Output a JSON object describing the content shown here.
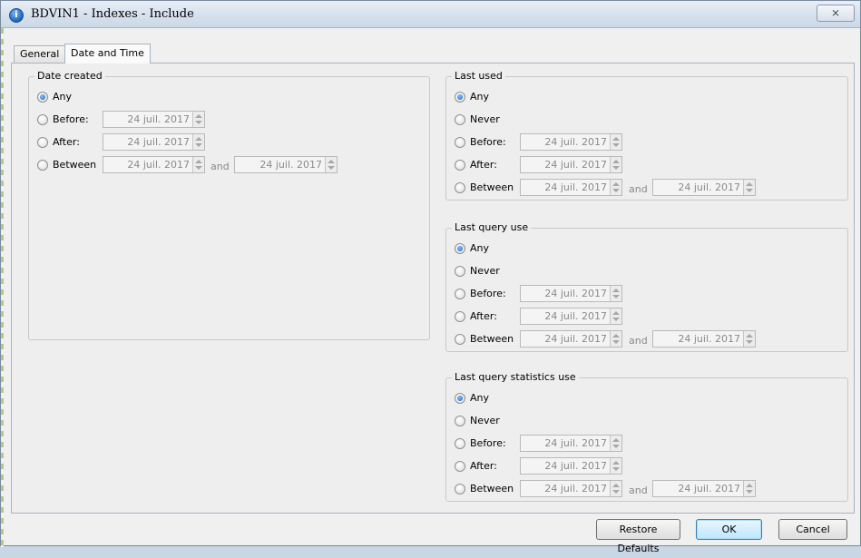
{
  "window": {
    "title": "BDVIN1 - Indexes - Include",
    "close_symbol": "⨯"
  },
  "tabs": [
    {
      "label": "General",
      "active": false
    },
    {
      "label": "Date and Time",
      "active": true
    }
  ],
  "date_created": {
    "title": "Date created",
    "options": [
      {
        "label": "Any",
        "checked": true
      },
      {
        "label": "Before:",
        "date": "24 juil. 2017"
      },
      {
        "label": "After:",
        "date": "24 juil. 2017"
      },
      {
        "label": "Between",
        "date": "24 juil. 2017",
        "and_label": "and",
        "date2": "24 juil. 2017"
      }
    ]
  },
  "last_used": {
    "title": "Last used",
    "options": [
      {
        "label": "Any",
        "checked": true
      },
      {
        "label": "Never"
      },
      {
        "label": "Before:",
        "date": "24 juil. 2017"
      },
      {
        "label": "After:",
        "date": "24 juil. 2017"
      },
      {
        "label": "Between",
        "date": "24 juil. 2017",
        "and_label": "and",
        "date2": "24 juil. 2017"
      }
    ]
  },
  "last_query_use": {
    "title": "Last query use",
    "options": [
      {
        "label": "Any",
        "checked": true
      },
      {
        "label": "Never"
      },
      {
        "label": "Before:",
        "date": "24 juil. 2017"
      },
      {
        "label": "After:",
        "date": "24 juil. 2017"
      },
      {
        "label": "Between",
        "date": "24 juil. 2017",
        "and_label": "and",
        "date2": "24 juil. 2017"
      }
    ]
  },
  "last_query_statistics_use": {
    "title": "Last query statistics use",
    "options": [
      {
        "label": "Any",
        "checked": true
      },
      {
        "label": "Never"
      },
      {
        "label": "Before:",
        "date": "24 juil. 2017"
      },
      {
        "label": "After:",
        "date": "24 juil. 2017"
      },
      {
        "label": "Between",
        "date": "24 juil. 2017",
        "and_label": "and",
        "date2": "24 juil. 2017"
      }
    ]
  },
  "buttons": {
    "restore_defaults": "Restore Defaults",
    "ok": "OK",
    "cancel": "Cancel"
  },
  "colors": {
    "accent": "#1e63c4",
    "default_button": "#bee6fd"
  }
}
